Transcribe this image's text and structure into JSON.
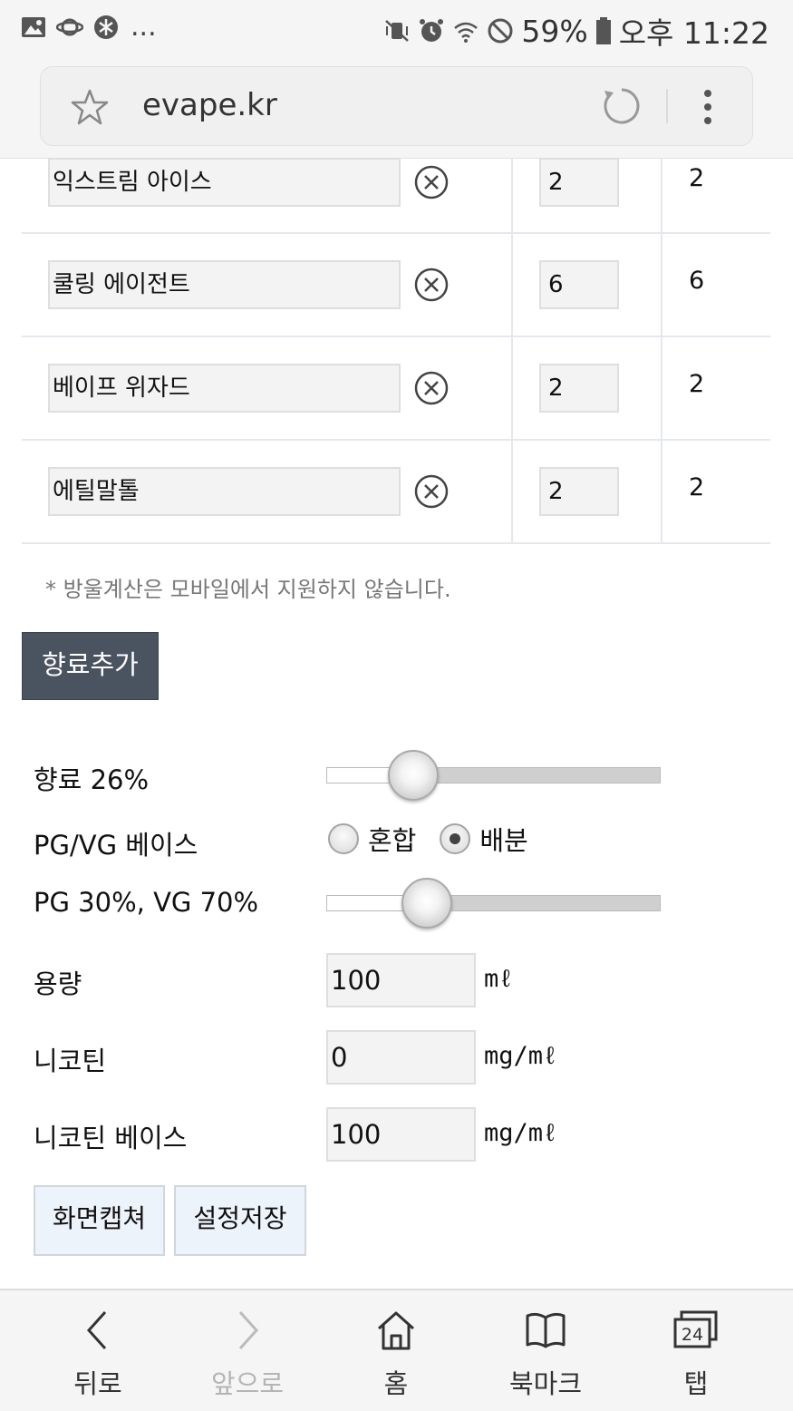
{
  "status_bar": {
    "left_icons": [
      "image-icon",
      "planet-icon",
      "game-icon"
    ],
    "more": "...",
    "battery": "59%",
    "time": "오후 11:22"
  },
  "browser": {
    "url": "evape.kr"
  },
  "flavors": [
    {
      "name": "익스트림 아이스",
      "qty": "2",
      "result": "2"
    },
    {
      "name": "쿨링 에이전트",
      "qty": "6",
      "result": "6"
    },
    {
      "name": "베이프 위자드",
      "qty": "2",
      "result": "2"
    },
    {
      "name": "에틸말톨",
      "qty": "2",
      "result": "2"
    }
  ],
  "note": "* 방울계산은 모바일에서 지원하지 않습니다.",
  "add_button": "향료추가",
  "flavor_slider": {
    "label": "향료 26%",
    "value": 26
  },
  "pgvg": {
    "label": "PG/VG 베이스",
    "options": [
      "혼합",
      "배분"
    ],
    "selected": "배분"
  },
  "ratio_slider": {
    "label": "PG 30%, VG 70%",
    "value": 30
  },
  "volume": {
    "label": "용량",
    "value": "100",
    "unit": "mℓ"
  },
  "nicotine": {
    "label": "니코틴",
    "value": "0",
    "unit": "mg/mℓ"
  },
  "nicotine_base": {
    "label": "니코틴 베이스",
    "value": "100",
    "unit": "mg/mℓ"
  },
  "actions": {
    "capture": "화면캡쳐",
    "save": "설정저장"
  },
  "nav": {
    "back": "뒤로",
    "forward": "앞으로",
    "home": "홈",
    "bookmarks": "북마크",
    "tabs": "탭",
    "tab_count": "24"
  }
}
